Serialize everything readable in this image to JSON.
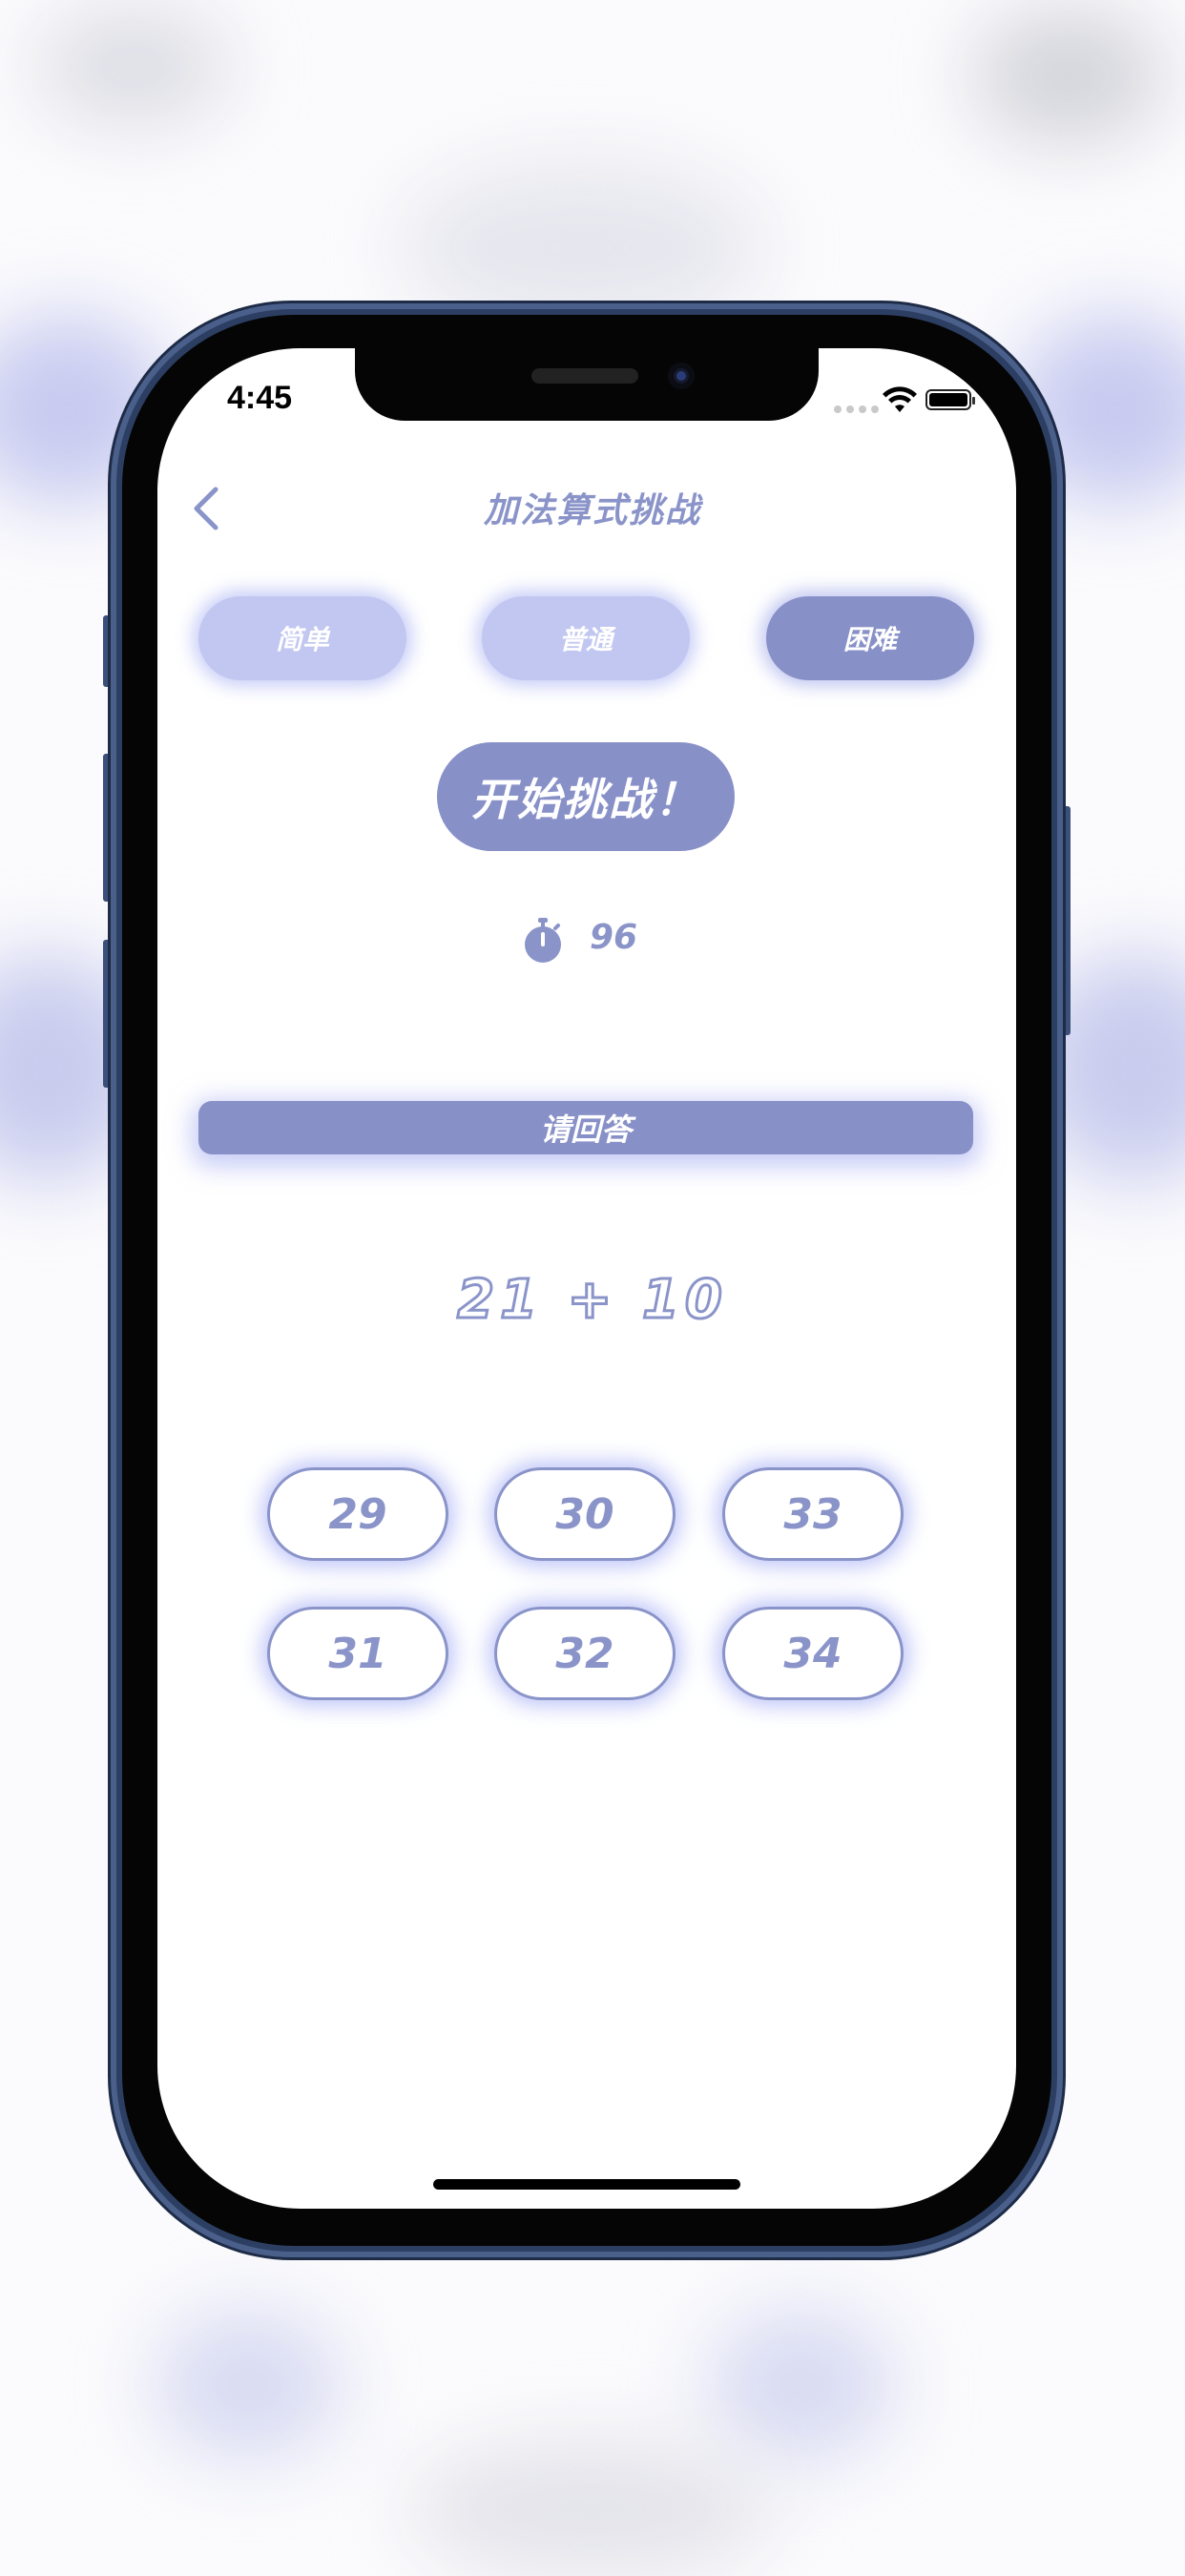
{
  "status_bar": {
    "time": "4:45",
    "signal_icon": "signal-dots-icon",
    "wifi_icon": "wifi-icon",
    "battery_icon": "battery-icon"
  },
  "nav": {
    "back_icon": "chevron-left-icon",
    "title": "加法算式挑战"
  },
  "difficulty": {
    "options": [
      {
        "label": "简单",
        "selected": false
      },
      {
        "label": "普通",
        "selected": false
      },
      {
        "label": "困难",
        "selected": true
      }
    ]
  },
  "start_button": "开始挑战！",
  "timer": {
    "icon": "stopwatch-icon",
    "value": "96"
  },
  "prompt": "请回答",
  "question": "21 + 10",
  "answers": [
    "29",
    "30",
    "33",
    "31",
    "32",
    "34"
  ],
  "colors": {
    "accent": "#8890c8",
    "accent_light": "#c1c7f1",
    "text_accent": "#8a94c9",
    "frame": "#2c3f63"
  }
}
